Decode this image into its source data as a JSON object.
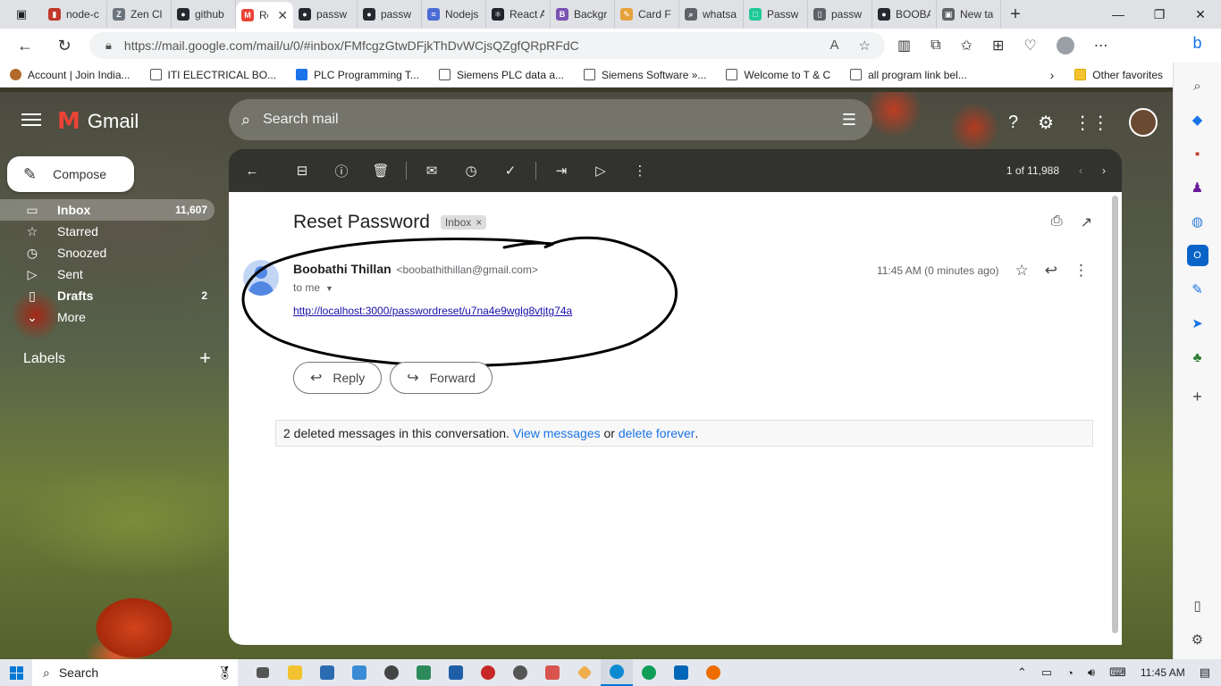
{
  "browser": {
    "tabs": [
      {
        "title": "node-c",
        "color": "#c0392b",
        "glyph": "▮"
      },
      {
        "title": "Zen Cl",
        "color": "#6c757d",
        "glyph": "Z"
      },
      {
        "title": "github",
        "color": "#24292e",
        "glyph": "●"
      },
      {
        "title": "Re",
        "color": "#ea4335",
        "glyph": "M",
        "active": true
      },
      {
        "title": "passw",
        "color": "#24292e",
        "glyph": "●"
      },
      {
        "title": "passw",
        "color": "#24292e",
        "glyph": "●"
      },
      {
        "title": "Nodejs",
        "color": "#4a6cd4",
        "glyph": "≡"
      },
      {
        "title": "React A",
        "color": "#20232a",
        "glyph": "⚛"
      },
      {
        "title": "Backgr",
        "color": "#7952b3",
        "glyph": "B"
      },
      {
        "title": "Card F",
        "color": "#e6a23c",
        "glyph": "✎"
      },
      {
        "title": "whatsa",
        "color": "#5f6368",
        "glyph": "⌕"
      },
      {
        "title": "Passw",
        "color": "#20c997",
        "glyph": "□"
      },
      {
        "title": "passw",
        "color": "#5f6368",
        "glyph": "▯"
      },
      {
        "title": "BOOBA",
        "color": "#24292e",
        "glyph": "●"
      },
      {
        "title": "New ta",
        "color": "#5f6368",
        "glyph": "▣"
      }
    ],
    "url": "https://mail.google.com/mail/u/0/#inbox/FMfcgzGtwDFjkThDvWCjsQZgfQRpRFdC",
    "favorites": [
      {
        "label": "Account | Join India...",
        "type": "emblem"
      },
      {
        "label": "ITI ELECTRICAL BO...",
        "type": "page"
      },
      {
        "label": "PLC Programming T...",
        "type": "blue"
      },
      {
        "label": "Siemens PLC data a...",
        "type": "page"
      },
      {
        "label": "Siemens Software »...",
        "type": "page"
      },
      {
        "label": "Welcome to T & C",
        "type": "page"
      },
      {
        "label": "all program link bel...",
        "type": "page"
      }
    ],
    "other_favorites": "Other favorites"
  },
  "gmail": {
    "brand": "Gmail",
    "search_placeholder": "Search mail",
    "compose": "Compose",
    "nav": [
      {
        "label": "Inbox",
        "count": "11,607",
        "icon": "inbox-icon",
        "glyph": "▭",
        "active": true
      },
      {
        "label": "Starred",
        "count": "",
        "icon": "star-icon",
        "glyph": "☆"
      },
      {
        "label": "Snoozed",
        "count": "",
        "icon": "clock-icon",
        "glyph": "◷"
      },
      {
        "label": "Sent",
        "count": "",
        "icon": "send-icon",
        "glyph": "▷"
      },
      {
        "label": "Drafts",
        "count": "2",
        "icon": "file-icon",
        "glyph": "▯",
        "bold": true
      },
      {
        "label": "More",
        "count": "",
        "icon": "chevron-down-icon",
        "glyph": "⌄"
      }
    ],
    "labels_title": "Labels",
    "pager_text": "1 of 11,988",
    "email": {
      "subject": "Reset Password",
      "label_chip": "Inbox",
      "sender_name": "Boobathi Thillan",
      "sender_email": "<boobathithillan@gmail.com>",
      "to": "to me",
      "time": "11:45 AM (0 minutes ago)",
      "body_link": "http://localhost:3000/passwordreset/u7na4e9wglg8vtjtg74a"
    },
    "reply_label": "Reply",
    "forward_label": "Forward",
    "deleted_notice": {
      "text": "2 deleted messages in this conversation.",
      "view_link": "View messages",
      "or": "or",
      "delete_link": "delete forever",
      "period": "."
    }
  },
  "taskbar": {
    "search": "Search",
    "time": "11:45 AM"
  },
  "colors": {
    "gmail_red": "#ea4335",
    "link_blue": "#1a73e8",
    "accent": "#0078d4"
  }
}
